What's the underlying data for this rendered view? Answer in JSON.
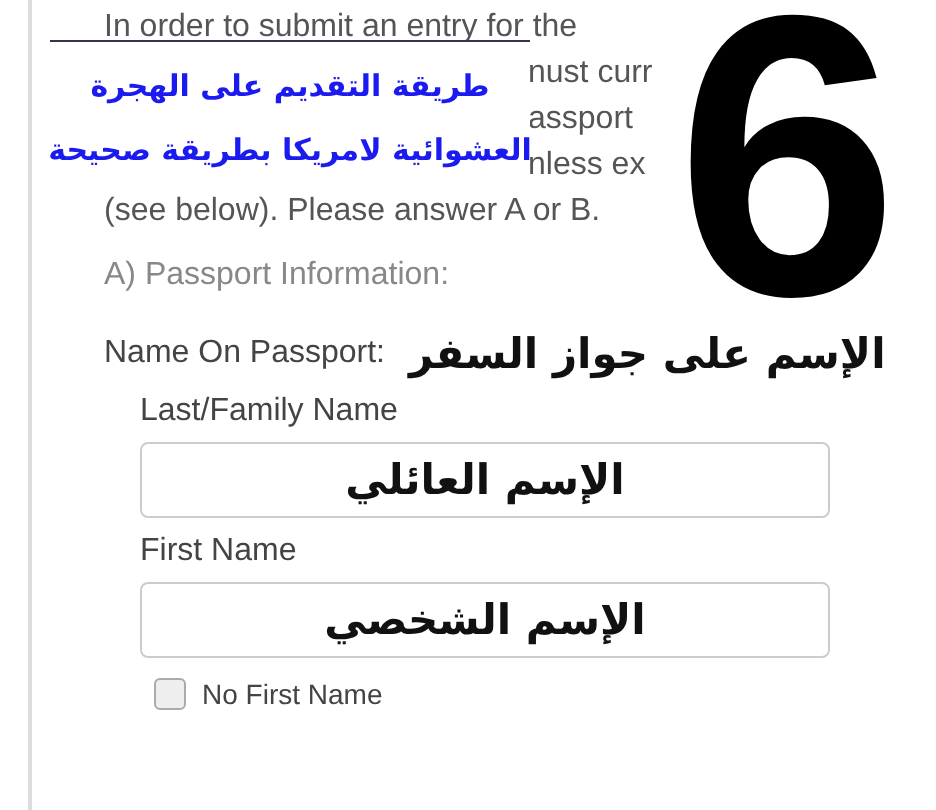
{
  "intro_lines": [
    {
      "kind": "full",
      "text": "In order to submit an entry for the"
    },
    {
      "kind": "fragment",
      "text": "nust curr"
    },
    {
      "kind": "fragment",
      "text": "assport"
    },
    {
      "kind": "fragment",
      "text": "nless ex"
    },
    {
      "kind": "full",
      "text": "(see below). Please answer A or B."
    }
  ],
  "section_heading": "A) Passport Information:",
  "name_label": "Name On Passport:",
  "name_annotation": "الإسم على جواز السفر",
  "fields": [
    {
      "label": "Last/Family Name",
      "value": "الإسم العائلي"
    },
    {
      "label": "First Name",
      "value": "الإسم الشخصي"
    }
  ],
  "checkbox": {
    "label": "No First Name",
    "checked": false
  },
  "overlay": {
    "title_lines": [
      "طريقة التقديم على الهجرة",
      "العشوائية لامريكا بطريقة صحيحة"
    ],
    "step_number": "6"
  }
}
